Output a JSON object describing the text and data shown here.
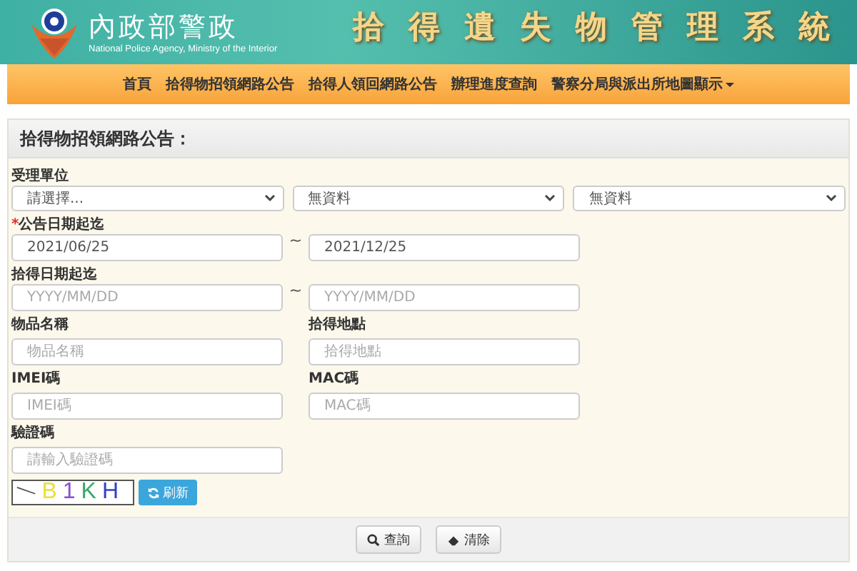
{
  "header": {
    "agency_name": "內政部警政",
    "agency_subtitle": "National Police Agency, Ministry of the Interior",
    "title": "拾得遺失物管理系統"
  },
  "nav": [
    {
      "label": "首頁",
      "dropdown": false
    },
    {
      "label": "拾得物招領網路公告",
      "dropdown": false
    },
    {
      "label": "拾得人領回網路公告",
      "dropdown": false
    },
    {
      "label": "辦理進度查詢",
      "dropdown": false
    },
    {
      "label": "警察分局與派出所地圖顯示",
      "dropdown": true
    }
  ],
  "panel": {
    "title": "拾得物招領網路公告：",
    "unit": {
      "label": "受理單位",
      "selects": [
        {
          "value": "請選擇..."
        },
        {
          "value": "無資料"
        },
        {
          "value": "無資料"
        }
      ]
    },
    "rows": [
      {
        "kind": "range",
        "required_mark": "*",
        "label": "公告日期起迄",
        "separator": "~",
        "fields": [
          {
            "value": "2021/06/25"
          },
          {
            "value": "2021/12/25"
          }
        ]
      },
      {
        "kind": "range",
        "label": "拾得日期起迄",
        "separator": "~",
        "fields": [
          {
            "placeholder": "YYYY/MM/DD"
          },
          {
            "placeholder": "YYYY/MM/DD"
          }
        ]
      },
      {
        "kind": "pair",
        "items": [
          {
            "label": "物品名稱",
            "placeholder": "物品名稱"
          },
          {
            "label": "拾得地點",
            "placeholder": "拾得地點"
          }
        ]
      },
      {
        "kind": "pair",
        "items": [
          {
            "label": "IMEI碼",
            "placeholder": "IMEI碼"
          },
          {
            "label": "MAC碼",
            "placeholder": "MAC碼"
          }
        ]
      },
      {
        "kind": "single",
        "label": "驗證碼",
        "placeholder": "請輸入驗證碼"
      }
    ],
    "captcha": {
      "text": "B1KH",
      "refresh_label": "刷新"
    },
    "buttons": [
      {
        "kind": "search",
        "label": "查詢"
      },
      {
        "kind": "clear",
        "label": "清除"
      }
    ]
  }
}
